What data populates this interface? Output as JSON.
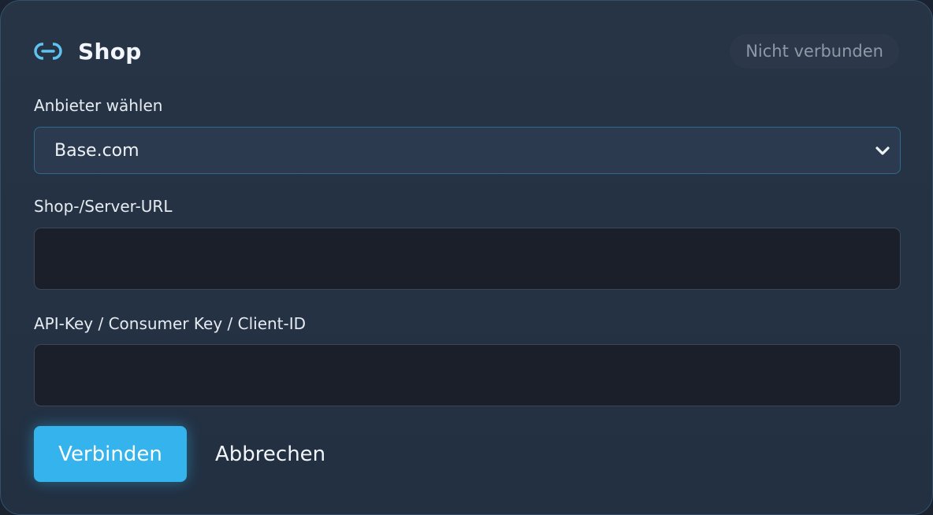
{
  "header": {
    "icon": "link-icon",
    "title": "Shop",
    "status_badge": "Nicht verbunden"
  },
  "provider": {
    "label": "Anbieter wählen",
    "selected": "Base.com",
    "icon": "chevron-down-icon"
  },
  "url_field": {
    "label": "Shop-/Server-URL",
    "value": "",
    "placeholder": ""
  },
  "key_field": {
    "label": "API-Key / Consumer Key / Client-ID",
    "value": "",
    "placeholder": ""
  },
  "actions": {
    "connect_label": "Verbinden",
    "cancel_label": "Abbrechen"
  },
  "colors": {
    "accent": "#34b3ec",
    "card_background": "#273446",
    "input_background": "#1a1f2a",
    "badge_text": "#8e99a8"
  }
}
